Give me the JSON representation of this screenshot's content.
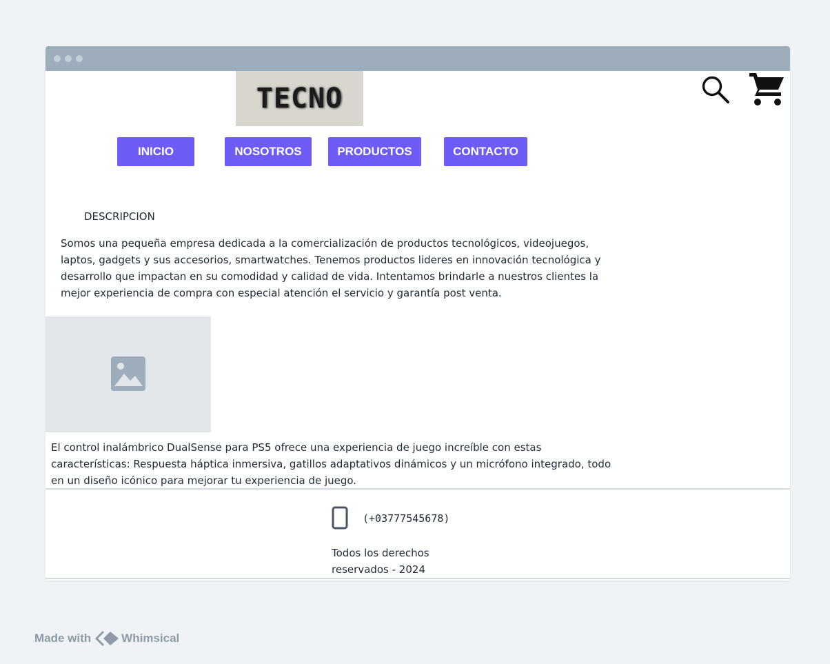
{
  "header": {
    "logo_text": "TECNO",
    "icons": {
      "search": "search-icon",
      "cart": "cart-icon"
    }
  },
  "nav": {
    "items": [
      {
        "label": "INICIO"
      },
      {
        "label": "NOSOTROS"
      },
      {
        "label": "PRODUCTOS"
      },
      {
        "label": "CONTACTO"
      }
    ]
  },
  "description": {
    "title": "DESCRIPCION",
    "text": "Somos una pequeña empresa dedicada a la comercialización de productos tecnológicos, videojuegos, laptos, gadgets y sus accesorios, smartwatches. Tenemos productos lideres en innovación tecnológica y desarrollo que impactan en su comodidad y calidad de vida. Intentamos brindarle a nuestros clientes la mejor experiencia de compra con especial atención el servicio y garantía post venta."
  },
  "product": {
    "image_icon": "image-icon",
    "text": "El control inalámbrico DualSense para PS5 ofrece una experiencia de juego increíble con estas características: Respuesta háptica inmersiva, gatillos adaptativos dinámicos y un micrófono integrado, todo en un diseño icónico para mejorar tu experiencia de juego."
  },
  "footer": {
    "phone": "(+03777545678)",
    "rights": "Todos los derechos reservados - 2024",
    "phone_icon": "tablet-icon"
  },
  "branding": {
    "made_with": "Made with",
    "brand": "Whimsical"
  },
  "colors": {
    "page_bg": "#eff3f6",
    "titlebar": "#9dadbb",
    "nav_button": "#6e5cf6",
    "placeholder_bg": "#e2e6ea"
  }
}
